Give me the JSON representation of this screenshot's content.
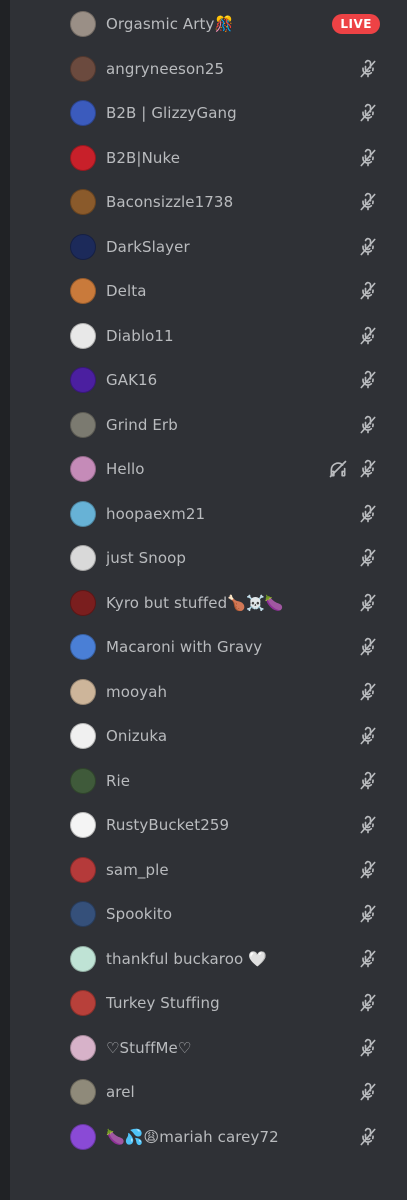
{
  "colors": {
    "background": "#2f3136",
    "rail": "#202225",
    "name_text": "#b9bbbe",
    "icon": "#b9bbbe",
    "live_badge": "#ed4245"
  },
  "members": [
    {
      "name": "Orgasmic Arty🎊",
      "avatar_color": "#9a8f86",
      "live": true,
      "muted": false,
      "deafened": false
    },
    {
      "name": "angryneeson25",
      "avatar_color": "#6b4a3e",
      "live": false,
      "muted": true,
      "deafened": false
    },
    {
      "name": "B2B | GlizzyGang",
      "avatar_color": "#3b5bbd",
      "live": false,
      "muted": true,
      "deafened": false
    },
    {
      "name": "B2B|Nuke",
      "avatar_color": "#c8202a",
      "live": false,
      "muted": true,
      "deafened": false
    },
    {
      "name": "Baconsizzle1738",
      "avatar_color": "#8a5a2b",
      "live": false,
      "muted": true,
      "deafened": false
    },
    {
      "name": "DarkSlayer",
      "avatar_color": "#1c2a5a",
      "live": false,
      "muted": true,
      "deafened": false
    },
    {
      "name": "Delta",
      "avatar_color": "#c97a3b",
      "live": false,
      "muted": true,
      "deafened": false
    },
    {
      "name": "Diablo11",
      "avatar_color": "#e8e8e8",
      "live": false,
      "muted": true,
      "deafened": false
    },
    {
      "name": "GAK16",
      "avatar_color": "#4b1fa0",
      "live": false,
      "muted": true,
      "deafened": false
    },
    {
      "name": "Grind Erb",
      "avatar_color": "#7b7a70",
      "live": false,
      "muted": true,
      "deafened": false
    },
    {
      "name": "Hello",
      "avatar_color": "#c58bb8",
      "live": false,
      "muted": true,
      "deafened": true
    },
    {
      "name": "hoopaexm21",
      "avatar_color": "#67b2d6",
      "live": false,
      "muted": true,
      "deafened": false
    },
    {
      "name": "just Snoop",
      "avatar_color": "#d9d9d9",
      "live": false,
      "muted": true,
      "deafened": false
    },
    {
      "name": "Kyro but stuffed🍗☠️🍆",
      "avatar_color": "#7a1e1e",
      "live": false,
      "muted": true,
      "deafened": false
    },
    {
      "name": "Macaroni with Gravy",
      "avatar_color": "#4a7fd6",
      "live": false,
      "muted": true,
      "deafened": false
    },
    {
      "name": "mooyah",
      "avatar_color": "#cdb59a",
      "live": false,
      "muted": true,
      "deafened": false
    },
    {
      "name": "Onizuka",
      "avatar_color": "#f0f0f0",
      "live": false,
      "muted": true,
      "deafened": false
    },
    {
      "name": "Rie",
      "avatar_color": "#3f5a3a",
      "live": false,
      "muted": true,
      "deafened": false
    },
    {
      "name": "RustyBucket259",
      "avatar_color": "#f4f4f4",
      "live": false,
      "muted": true,
      "deafened": false
    },
    {
      "name": "sam_ple",
      "avatar_color": "#b53a3a",
      "live": false,
      "muted": true,
      "deafened": false
    },
    {
      "name": "Spookito",
      "avatar_color": "#35507a",
      "live": false,
      "muted": true,
      "deafened": false
    },
    {
      "name": "thankful buckaroo 🤍",
      "avatar_color": "#bfe3d5",
      "live": false,
      "muted": true,
      "deafened": false
    },
    {
      "name": "Turkey Stuffing",
      "avatar_color": "#b8403a",
      "live": false,
      "muted": true,
      "deafened": false
    },
    {
      "name": "♡StuffMe♡",
      "avatar_color": "#d7b2c9",
      "live": false,
      "muted": true,
      "deafened": false
    },
    {
      "name": "arel",
      "avatar_color": "#8f8a7a",
      "live": false,
      "muted": true,
      "deafened": false
    },
    {
      "name": "🍆💦😩mariah carey72",
      "avatar_color": "#8a4ad6",
      "live": false,
      "muted": true,
      "deafened": false
    }
  ],
  "live_label": "LIVE",
  "icons": {
    "mute": "mic-muted-icon",
    "deafen": "headphones-deafened-icon"
  }
}
